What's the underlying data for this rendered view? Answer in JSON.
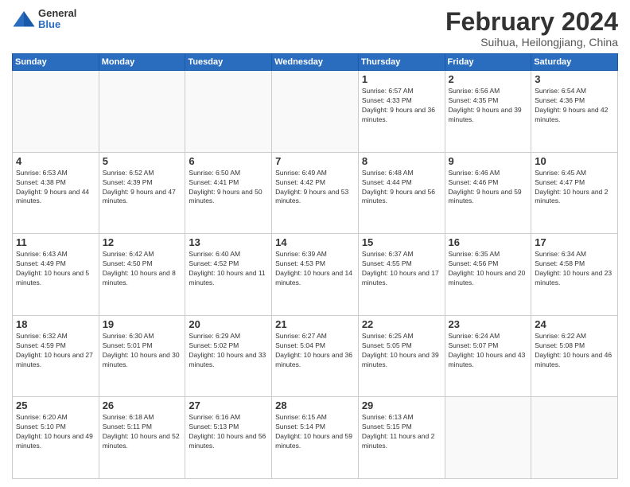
{
  "header": {
    "logo_general": "General",
    "logo_blue": "Blue",
    "month_title": "February 2024",
    "location": "Suihua, Heilongjiang, China"
  },
  "weekdays": [
    "Sunday",
    "Monday",
    "Tuesday",
    "Wednesday",
    "Thursday",
    "Friday",
    "Saturday"
  ],
  "weeks": [
    [
      {
        "day": "",
        "empty": true
      },
      {
        "day": "",
        "empty": true
      },
      {
        "day": "",
        "empty": true
      },
      {
        "day": "",
        "empty": true
      },
      {
        "day": "1",
        "sunrise": "6:57 AM",
        "sunset": "4:33 PM",
        "daylight": "9 hours and 36 minutes."
      },
      {
        "day": "2",
        "sunrise": "6:56 AM",
        "sunset": "4:35 PM",
        "daylight": "9 hours and 39 minutes."
      },
      {
        "day": "3",
        "sunrise": "6:54 AM",
        "sunset": "4:36 PM",
        "daylight": "9 hours and 42 minutes."
      }
    ],
    [
      {
        "day": "4",
        "sunrise": "6:53 AM",
        "sunset": "4:38 PM",
        "daylight": "9 hours and 44 minutes."
      },
      {
        "day": "5",
        "sunrise": "6:52 AM",
        "sunset": "4:39 PM",
        "daylight": "9 hours and 47 minutes."
      },
      {
        "day": "6",
        "sunrise": "6:50 AM",
        "sunset": "4:41 PM",
        "daylight": "9 hours and 50 minutes."
      },
      {
        "day": "7",
        "sunrise": "6:49 AM",
        "sunset": "4:42 PM",
        "daylight": "9 hours and 53 minutes."
      },
      {
        "day": "8",
        "sunrise": "6:48 AM",
        "sunset": "4:44 PM",
        "daylight": "9 hours and 56 minutes."
      },
      {
        "day": "9",
        "sunrise": "6:46 AM",
        "sunset": "4:46 PM",
        "daylight": "9 hours and 59 minutes."
      },
      {
        "day": "10",
        "sunrise": "6:45 AM",
        "sunset": "4:47 PM",
        "daylight": "10 hours and 2 minutes."
      }
    ],
    [
      {
        "day": "11",
        "sunrise": "6:43 AM",
        "sunset": "4:49 PM",
        "daylight": "10 hours and 5 minutes."
      },
      {
        "day": "12",
        "sunrise": "6:42 AM",
        "sunset": "4:50 PM",
        "daylight": "10 hours and 8 minutes."
      },
      {
        "day": "13",
        "sunrise": "6:40 AM",
        "sunset": "4:52 PM",
        "daylight": "10 hours and 11 minutes."
      },
      {
        "day": "14",
        "sunrise": "6:39 AM",
        "sunset": "4:53 PM",
        "daylight": "10 hours and 14 minutes."
      },
      {
        "day": "15",
        "sunrise": "6:37 AM",
        "sunset": "4:55 PM",
        "daylight": "10 hours and 17 minutes."
      },
      {
        "day": "16",
        "sunrise": "6:35 AM",
        "sunset": "4:56 PM",
        "daylight": "10 hours and 20 minutes."
      },
      {
        "day": "17",
        "sunrise": "6:34 AM",
        "sunset": "4:58 PM",
        "daylight": "10 hours and 23 minutes."
      }
    ],
    [
      {
        "day": "18",
        "sunrise": "6:32 AM",
        "sunset": "4:59 PM",
        "daylight": "10 hours and 27 minutes."
      },
      {
        "day": "19",
        "sunrise": "6:30 AM",
        "sunset": "5:01 PM",
        "daylight": "10 hours and 30 minutes."
      },
      {
        "day": "20",
        "sunrise": "6:29 AM",
        "sunset": "5:02 PM",
        "daylight": "10 hours and 33 minutes."
      },
      {
        "day": "21",
        "sunrise": "6:27 AM",
        "sunset": "5:04 PM",
        "daylight": "10 hours and 36 minutes."
      },
      {
        "day": "22",
        "sunrise": "6:25 AM",
        "sunset": "5:05 PM",
        "daylight": "10 hours and 39 minutes."
      },
      {
        "day": "23",
        "sunrise": "6:24 AM",
        "sunset": "5:07 PM",
        "daylight": "10 hours and 43 minutes."
      },
      {
        "day": "24",
        "sunrise": "6:22 AM",
        "sunset": "5:08 PM",
        "daylight": "10 hours and 46 minutes."
      }
    ],
    [
      {
        "day": "25",
        "sunrise": "6:20 AM",
        "sunset": "5:10 PM",
        "daylight": "10 hours and 49 minutes."
      },
      {
        "day": "26",
        "sunrise": "6:18 AM",
        "sunset": "5:11 PM",
        "daylight": "10 hours and 52 minutes."
      },
      {
        "day": "27",
        "sunrise": "6:16 AM",
        "sunset": "5:13 PM",
        "daylight": "10 hours and 56 minutes."
      },
      {
        "day": "28",
        "sunrise": "6:15 AM",
        "sunset": "5:14 PM",
        "daylight": "10 hours and 59 minutes."
      },
      {
        "day": "29",
        "sunrise": "6:13 AM",
        "sunset": "5:15 PM",
        "daylight": "11 hours and 2 minutes."
      },
      {
        "day": "",
        "empty": true
      },
      {
        "day": "",
        "empty": true
      }
    ]
  ]
}
